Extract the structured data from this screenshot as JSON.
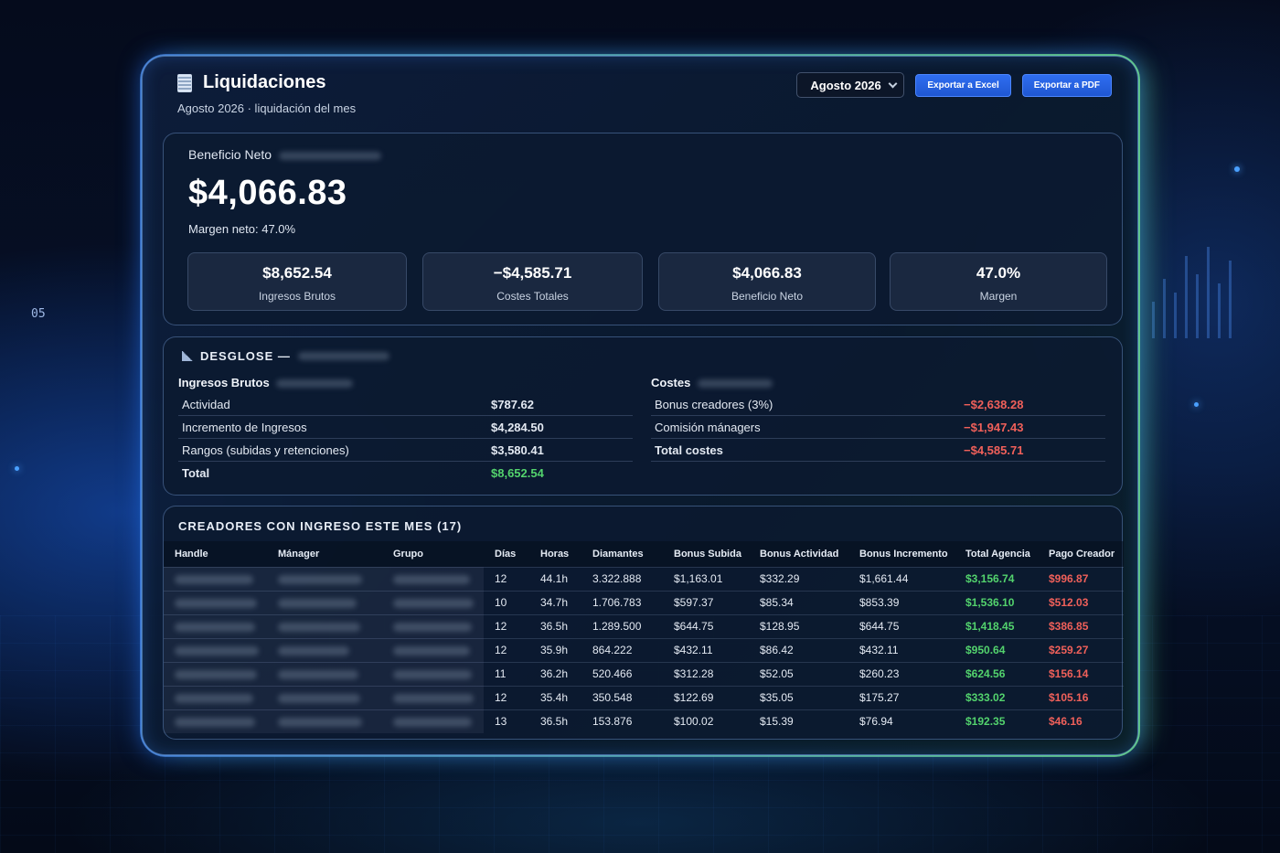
{
  "background": {
    "readout": "05"
  },
  "header": {
    "title": "Liquidaciones",
    "subtitle": "Agosto 2026 · liquidación del mes",
    "month_select": "Agosto 2026",
    "export_excel": "Exportar a Excel",
    "export_pdf": "Exportar a PDF"
  },
  "summary": {
    "label": "Beneficio Neto",
    "value": "$4,066.83",
    "margin": "Margen neto: 47.0%",
    "kpis": [
      {
        "value": "$8,652.54",
        "label": "Ingresos Brutos"
      },
      {
        "value": "−$4,585.71",
        "label": "Costes Totales"
      },
      {
        "value": "$4,066.83",
        "label": "Beneficio Neto"
      },
      {
        "value": "47.0%",
        "label": "Margen"
      }
    ]
  },
  "breakdown": {
    "title": "DESGLOSE —",
    "income": {
      "heading": "Ingresos Brutos",
      "rows": [
        {
          "label": "Actividad",
          "amount": "$787.62"
        },
        {
          "label": "Incremento de Ingresos",
          "amount": "$4,284.50"
        },
        {
          "label": "Rangos (subidas y retenciones)",
          "amount": "$3,580.41"
        }
      ],
      "total_label": "Total",
      "total_amount": "$8,652.54"
    },
    "costs": {
      "heading": "Costes",
      "rows": [
        {
          "label": "Bonus creadores (3%)",
          "amount": "−$2,638.28"
        },
        {
          "label": "Comisión mánagers",
          "amount": "−$1,947.43"
        }
      ],
      "total_label": "Total costes",
      "total_amount": "−$4,585.71"
    }
  },
  "creators": {
    "title": "CREADORES CON INGRESO ESTE MES (17)",
    "columns": [
      "Handle",
      "Mánager",
      "Grupo",
      "Días",
      "Horas",
      "Diamantes",
      "Bonus Subida",
      "Bonus Actividad",
      "Bonus Incremento",
      "Total Agencia",
      "Pago Creador"
    ],
    "rows": [
      [
        "12",
        "44.1h",
        "3.322.888",
        "$1,163.01",
        "$332.29",
        "$1,661.44",
        "$3,156.74",
        "$996.87"
      ],
      [
        "10",
        "34.7h",
        "1.706.783",
        "$597.37",
        "$85.34",
        "$853.39",
        "$1,536.10",
        "$512.03"
      ],
      [
        "12",
        "36.5h",
        "1.289.500",
        "$644.75",
        "$128.95",
        "$644.75",
        "$1,418.45",
        "$386.85"
      ],
      [
        "12",
        "35.9h",
        "864.222",
        "$432.11",
        "$86.42",
        "$432.11",
        "$950.64",
        "$259.27"
      ],
      [
        "11",
        "36.2h",
        "520.466",
        "$312.28",
        "$52.05",
        "$260.23",
        "$624.56",
        "$156.14"
      ],
      [
        "12",
        "35.4h",
        "350.548",
        "$122.69",
        "$35.05",
        "$175.27",
        "$333.02",
        "$105.16"
      ],
      [
        "13",
        "36.5h",
        "153.876",
        "$100.02",
        "$15.39",
        "$76.94",
        "$192.35",
        "$46.16"
      ]
    ]
  },
  "colors": {
    "accent": "#2f6ef0",
    "positive": "#53d36d",
    "negative": "#f0605a"
  }
}
